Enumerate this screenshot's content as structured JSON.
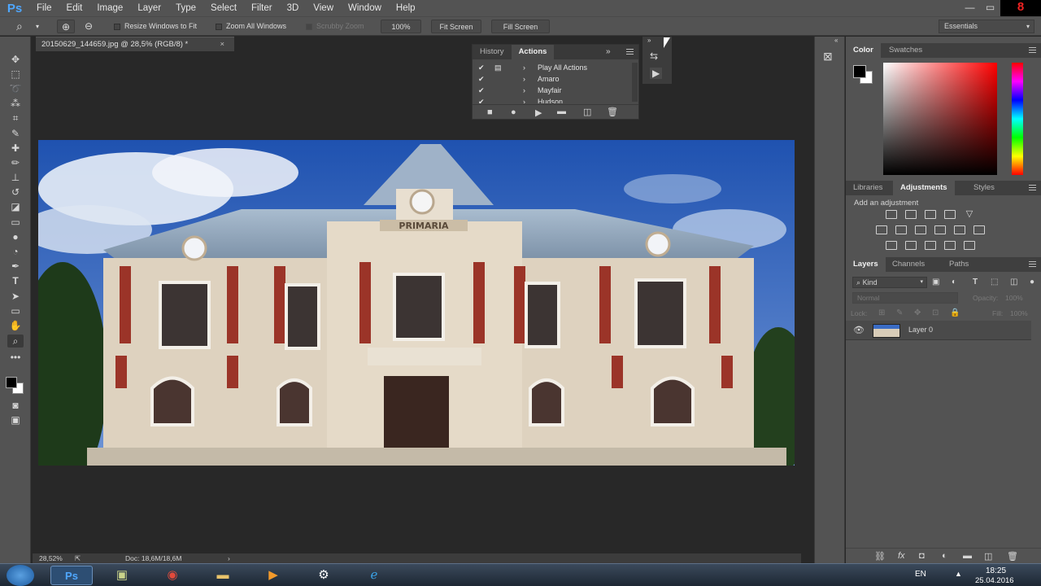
{
  "app": {
    "logo": "Ps"
  },
  "menu": [
    "File",
    "Edit",
    "Image",
    "Layer",
    "Type",
    "Select",
    "Filter",
    "3D",
    "View",
    "Window",
    "Help"
  ],
  "window_controls": {
    "minimize": "—",
    "maximize": "▭",
    "close": "8"
  },
  "options": {
    "resize_windows": "Resize Windows to Fit",
    "zoom_all": "Zoom All Windows",
    "scrubby": "Scrubby Zoom",
    "zoom_value": "100%",
    "fit_screen": "Fit Screen",
    "fill_screen": "Fill Screen",
    "workspace": "Essentials"
  },
  "document": {
    "tab_title": "20150629_144659.jpg @ 28,5% (RGB/8) *",
    "tab_close": "×",
    "zoom_status": "28,52%",
    "doc_status": "Doc: 18,6M/18,6M",
    "building_sign": "PRIMARIA"
  },
  "actions_panel": {
    "tabs": [
      "History",
      "Actions"
    ],
    "active_tab": "Actions",
    "rows": [
      {
        "label": "Play All Actions",
        "checked": true,
        "folder": true
      },
      {
        "label": "Amaro",
        "checked": true,
        "folder": false
      },
      {
        "label": "Mayfair",
        "checked": true,
        "folder": false
      },
      {
        "label": "Hudson",
        "checked": true,
        "folder": false
      }
    ]
  },
  "color_panel": {
    "tabs": [
      "Color",
      "Swatches"
    ],
    "active_tab": "Color",
    "foreground": "#000000",
    "background": "#ffffff",
    "hue": "#ff0000"
  },
  "adjustments_panel": {
    "tabs": [
      "Libraries",
      "Adjustments",
      "Styles"
    ],
    "active_tab": "Adjustments",
    "heading": "Add an adjustment"
  },
  "layers_panel": {
    "tabs": [
      "Layers",
      "Channels",
      "Paths"
    ],
    "active_tab": "Layers",
    "filter_kind": "Kind",
    "blend_mode": "Normal",
    "opacity_label": "Opacity:",
    "opacity_value": "100%",
    "lock_label": "Lock:",
    "fill_label": "Fill:",
    "fill_value": "100%",
    "layers": [
      {
        "name": "Layer 0",
        "visible": true
      }
    ]
  },
  "taskbar": {
    "language": "EN",
    "time": "18:25",
    "date": "25.04.2016"
  }
}
